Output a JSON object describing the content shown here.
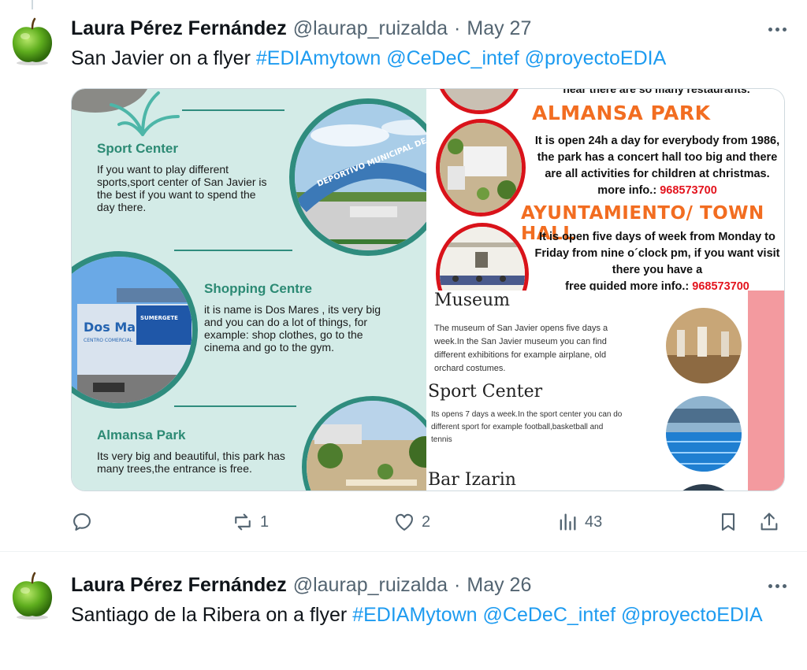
{
  "tweets": [
    {
      "author": "Laura Pérez Fernández",
      "handle": "@laurap_ruizalda",
      "date": "May 27",
      "text_plain": "San Javier on a flyer",
      "hashtag": "#EDIAmytown",
      "mention1": "@CeDeC_intef",
      "mention2": "@proyectoEDIA",
      "actions": {
        "replies": "",
        "reposts": "1",
        "likes": "2",
        "views": "43"
      }
    },
    {
      "author": "Laura Pérez Fernández",
      "handle": "@laurap_ruizalda",
      "date": "May 26",
      "text_plain": "Santiago de la Ribera on a flyer",
      "hashtag": "#EDIAMytown",
      "mention1": "@CeDeC_intef",
      "mention2": "@proyectoEDIA"
    }
  ],
  "flyer_left": {
    "sport_title": "Sport Center",
    "sport_body": "If you want to play different sports,sport center of San Javier is the best if you want to spend the day there.",
    "stadium_sign": "DEPORTIVO MUNICIPAL DE S",
    "shopping_title": "Shopping Centre",
    "shopping_body": "it is name is Dos Mares , its very big and you can do a lot of things, for example: shop clothes, go to the cinema  and go to the gym.",
    "mall_sign": "Dos Mares",
    "mall_sub": "CENTRO COMERCIAL",
    "mall_banner": "SUMERGETE",
    "park_title": "Almansa Park",
    "park_body": "Its very big and beautiful, this park has many trees,the entrance is free."
  },
  "flyer_right_top": {
    "top_cut": "near there are so many restaurants.",
    "park_title": "ALMANSA PARK",
    "park_body": "It is open 24h a day for everybody from 1986, the park has a concert hall too big and there are all activities for children at christmas.",
    "more_info_label": "more info.:",
    "park_phone": "968573700",
    "hall_title": "AYUNTAMIENTO/ TOWN HALL",
    "hall_body": "It is open five days of week from Monday to Friday from nine o´clock pm, if you want visit there you have a",
    "hall_cut": "free guided  more info.:",
    "hall_phone": "968573700"
  },
  "flyer_right_bottom": {
    "museum_title": "Museum",
    "museum_body": "The museum of San Javier opens five days a week.In the San Javier museum you can find different exhibitions for example airplane, old orchard costumes.",
    "sport_title": "Sport Center",
    "sport_body": "Its opens 7 days a week.In the sport center you can do different sport for example football,basketball and tennis",
    "bar_title": "Bar Izarin"
  },
  "icons": [
    "apple-avatar-icon",
    "more-icon",
    "reply-icon",
    "repost-icon",
    "like-icon",
    "views-icon",
    "bookmark-icon",
    "share-icon"
  ],
  "colors": {
    "link": "#1d9bf0",
    "secondary": "#536471",
    "flyer_teal": "#2c8a74",
    "flyer_orange": "#f26d21",
    "flyer_red": "#e3141e"
  }
}
